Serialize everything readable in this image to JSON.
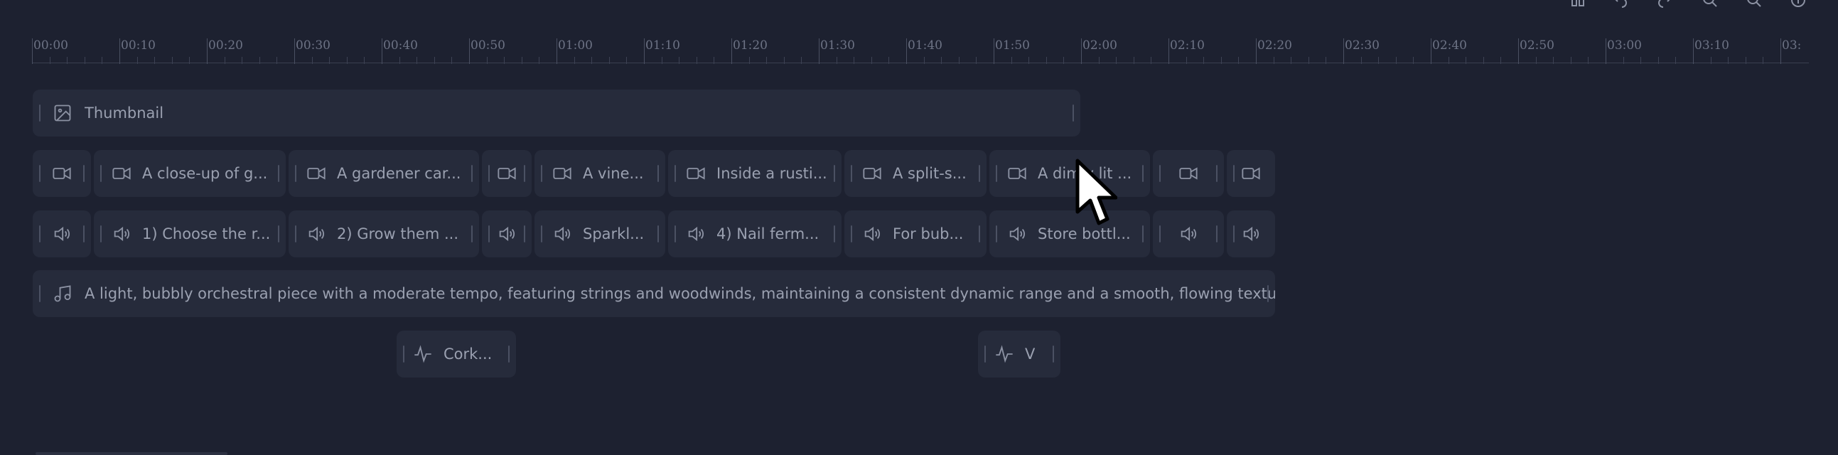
{
  "ruler": {
    "labels": [
      "00:00",
      "00:10",
      "00:20",
      "00:30",
      "00:40",
      "00:50",
      "01:00",
      "01:10",
      "01:20",
      "01:30",
      "01:40",
      "01:50",
      "02:00",
      "02:10",
      "02:20",
      "02:30",
      "02:40",
      "02:50",
      "03:00",
      "03:10",
      "03:"
    ]
  },
  "tracks": {
    "thumbnail": {
      "label": "Thumbnail"
    },
    "video": [
      "",
      "A close-up of g...",
      "A gardener car...",
      "",
      "A vine...",
      "Inside a rusti...",
      "A split-s...",
      "A dimly lit ...",
      "",
      ""
    ],
    "audio": [
      "",
      "1) Choose the r...",
      "2) Grow them ...",
      "",
      "Sparkl...",
      "4) Nail ferm...",
      "For bub...",
      "Store bottl...",
      "",
      ""
    ],
    "music": {
      "label": "A light, bubbly orchestral piece with a moderate tempo, featuring strings and woodwinds, maintaining a consistent dynamic range and a smooth, flowing texture."
    },
    "sfx": [
      "Cork...",
      "V"
    ]
  },
  "icons": {
    "thumbnail": "image-icon",
    "video": "video-camera-icon",
    "audio": "speaker-icon",
    "music": "music-note-icon",
    "sfx": "waveform-icon"
  }
}
